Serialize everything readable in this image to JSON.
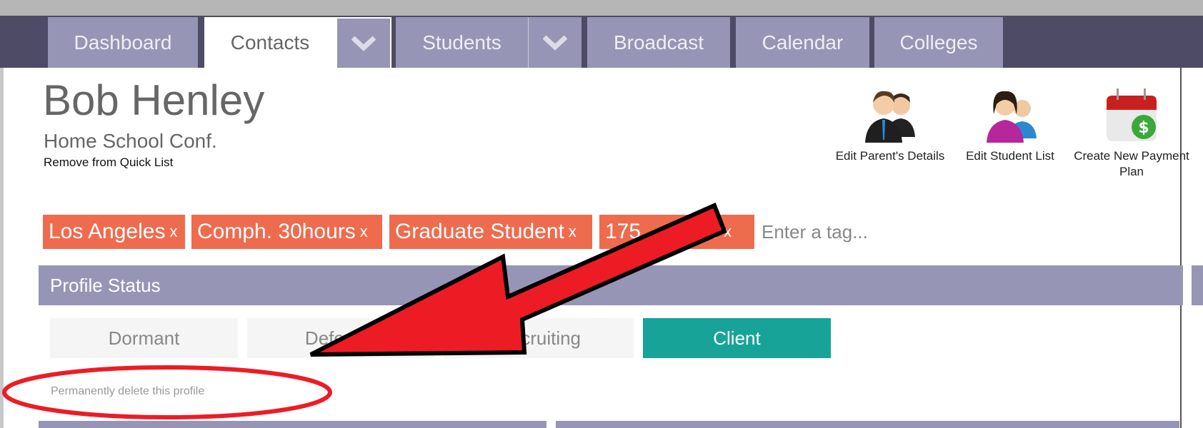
{
  "nav": {
    "tabs": [
      {
        "label": "Dashboard"
      },
      {
        "label": "Contacts",
        "active": true
      },
      {
        "label": "Students"
      },
      {
        "label": "Broadcast"
      },
      {
        "label": "Calendar"
      },
      {
        "label": "Colleges"
      }
    ]
  },
  "profile": {
    "name": "Bob Henley",
    "organization": "Home School Conf.",
    "remove_link": "Remove from Quick List"
  },
  "actions": [
    {
      "label": "Edit Parent's Details",
      "icon": "parents-icon"
    },
    {
      "label": "Edit Student List",
      "icon": "students-icon"
    },
    {
      "label": "Create New Payment Plan",
      "icon": "payment-calendar-icon"
    }
  ],
  "tags": {
    "items": [
      {
        "label": "Los Angeles"
      },
      {
        "label": "Comph. 30hours"
      },
      {
        "label": "Graduate Student"
      },
      {
        "label": "175          ar"
      }
    ],
    "remove_glyph": "x",
    "placeholder": "Enter a tag..."
  },
  "profile_status": {
    "title": "Profile Status",
    "options": [
      {
        "label": "Dormant"
      },
      {
        "label": "Deferred"
      },
      {
        "label": "Recruiting"
      },
      {
        "label": "Client",
        "selected": true
      }
    ],
    "delete_link": "Permanently delete this profile"
  },
  "colors": {
    "nav": "#4d4b66",
    "tab": "#9795b6",
    "tag": "#ef6b4e",
    "selected": "#17a398",
    "annotation": "#ed1c24"
  }
}
